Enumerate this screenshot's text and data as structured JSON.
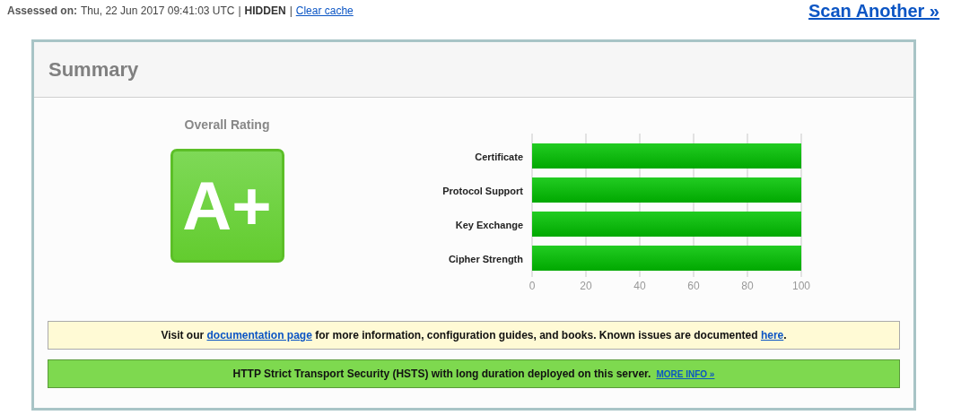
{
  "header": {
    "assessed_label": "Assessed on:",
    "assessed_value": "Thu, 22 Jun 2017 09:41:03 UTC",
    "separator_1": "|",
    "visibility": "HIDDEN",
    "separator_2": "|",
    "clear_cache": "Clear cache",
    "scan_another": "Scan Another »"
  },
  "summary": {
    "title": "Summary",
    "rating_label": "Overall Rating",
    "grade": "A+",
    "chart_data": {
      "type": "bar",
      "orientation": "horizontal",
      "categories": [
        "Certificate",
        "Protocol Support",
        "Key Exchange",
        "Cipher Strength"
      ],
      "values": [
        100,
        100,
        100,
        100
      ],
      "xlim": [
        0,
        100
      ],
      "grid": true,
      "xticks": [
        0,
        20,
        40,
        60,
        80,
        100
      ]
    },
    "notices": [
      {
        "kind": "info",
        "segments": [
          {
            "kind": "text",
            "text": "Visit our "
          },
          {
            "kind": "link",
            "text": "documentation page"
          },
          {
            "kind": "text",
            "text": " for more information, configuration guides, and books. Known issues are documented "
          },
          {
            "kind": "link",
            "text": "here"
          },
          {
            "kind": "text",
            "text": "."
          }
        ]
      },
      {
        "kind": "success",
        "segments": [
          {
            "kind": "text",
            "text": "HTTP Strict Transport Security (HSTS) with long duration deployed on this server."
          },
          {
            "kind": "small_link",
            "text": "MORE INFO »"
          }
        ]
      }
    ]
  }
}
